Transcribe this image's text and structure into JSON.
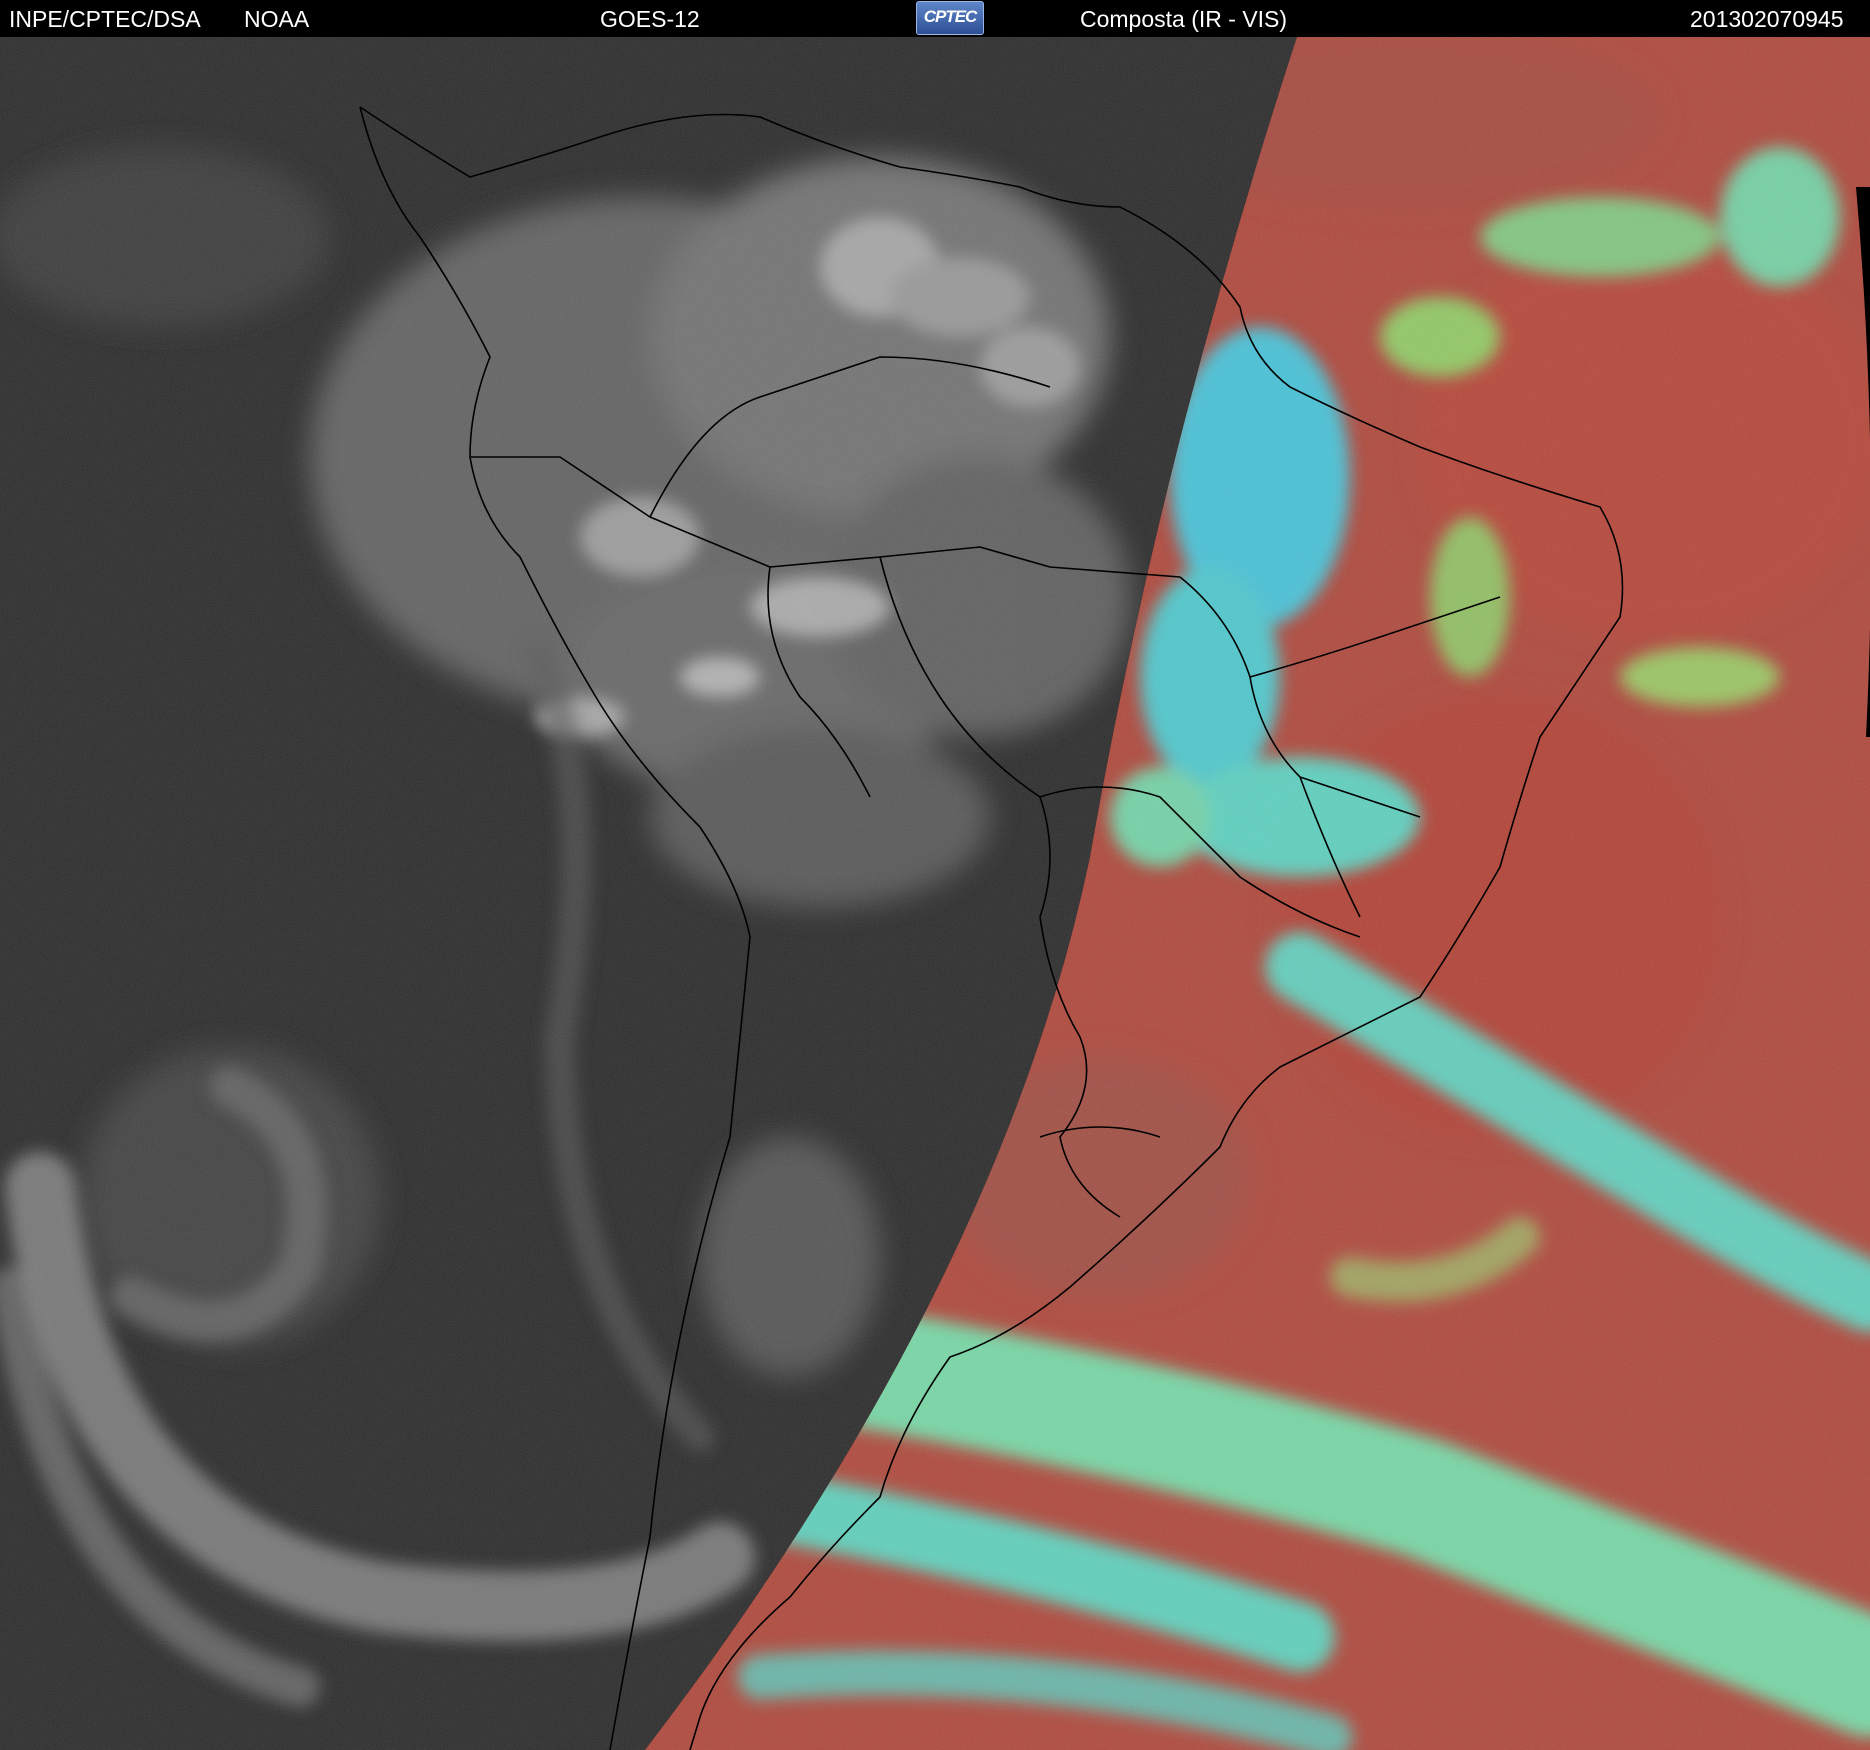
{
  "header": {
    "agency": "INPE/CPTEC/DSA",
    "partner": "NOAA",
    "satellite": "GOES-12",
    "logo_text": "CPTEC",
    "product": "Composta (IR - VIS)",
    "timestamp": "201302070945"
  },
  "colors": {
    "night_side": "#2b2b2b",
    "day_side_base": "#b04a3e",
    "low_cloud": "#6fe8b8",
    "high_cloud": "#3fd6e0",
    "coastline": "#000000"
  },
  "map": {
    "region": "South America",
    "legend": "none"
  }
}
